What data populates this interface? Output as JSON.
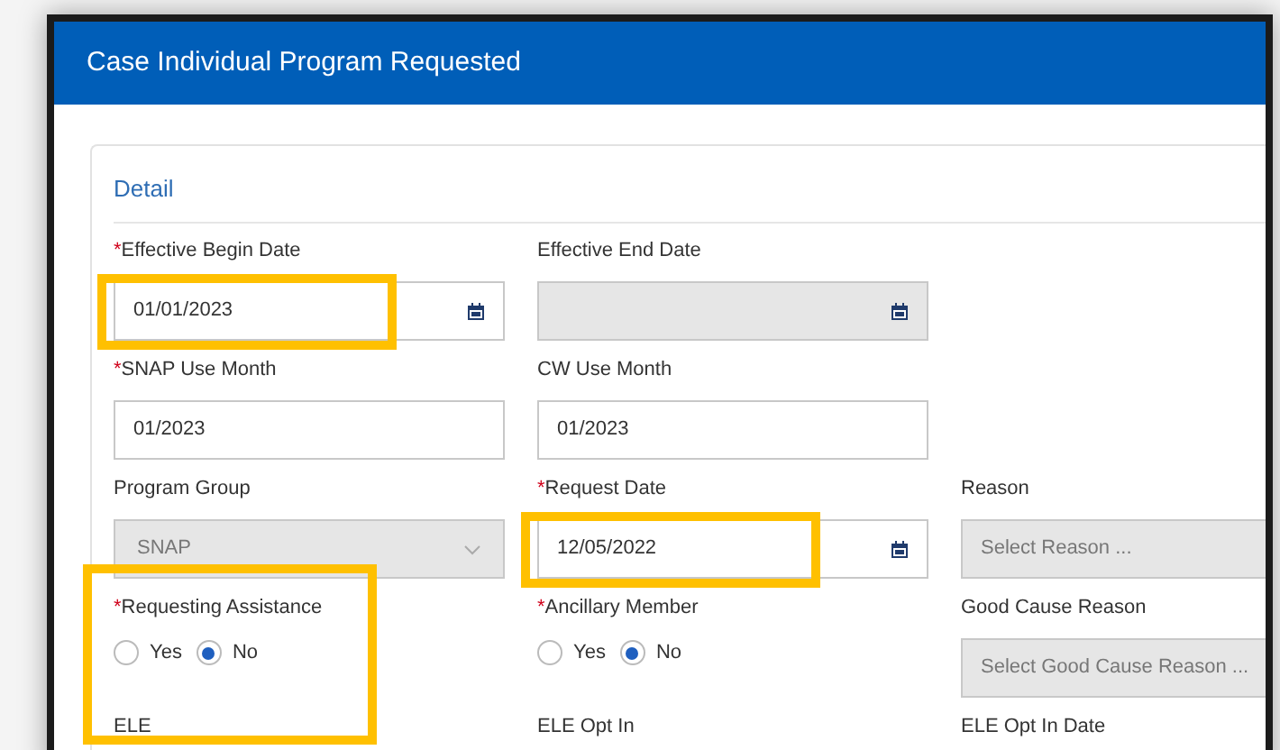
{
  "window": {
    "title": "Case Individual Program Requested"
  },
  "section": {
    "title": "Detail"
  },
  "rows": [
    [
      {
        "kind": "date",
        "label": "Effective Begin Date",
        "required_mark": "*",
        "value": "01/01/2023",
        "disabled": false,
        "highlighted": true
      },
      {
        "kind": "date",
        "label": "Effective End Date",
        "disabled": true,
        "highlighted": false
      }
    ],
    [
      {
        "kind": "text",
        "label": "SNAP Use Month",
        "required_mark": "*",
        "value": "01/2023",
        "disabled": false,
        "highlighted": false
      },
      {
        "kind": "text",
        "label": "CW Use Month",
        "value": "01/2023",
        "disabled": false,
        "highlighted": false
      }
    ],
    [
      {
        "kind": "select",
        "label": "Program Group",
        "value": "SNAP",
        "disabled": true,
        "highlighted": false
      },
      {
        "kind": "date",
        "label": "Request Date",
        "required_mark": "*",
        "value": "12/05/2022",
        "disabled": false,
        "highlighted": true
      },
      {
        "kind": "select",
        "label": "Reason",
        "placeholder": "Select Reason ...",
        "disabled": true,
        "highlighted": false
      }
    ],
    [
      {
        "kind": "radio",
        "label": "Requesting Assistance",
        "required_mark": "*",
        "highlighted": true,
        "options": [
          {
            "label": "Yes",
            "selected": false
          },
          {
            "label": "No",
            "selected": true
          }
        ]
      },
      {
        "kind": "radio",
        "label": "Ancillary Member",
        "required_mark": "*",
        "highlighted": false,
        "options": [
          {
            "label": "Yes",
            "selected": false
          },
          {
            "label": "No",
            "selected": true
          }
        ]
      },
      {
        "kind": "select",
        "label": "Good Cause Reason",
        "placeholder": "Select Good Cause Reason ...",
        "disabled": true,
        "highlighted": false
      }
    ],
    [
      {
        "kind": "label",
        "label": "ELE"
      },
      {
        "kind": "label",
        "label": "ELE Opt In"
      },
      {
        "kind": "label",
        "label": "ELE Opt In Date"
      }
    ]
  ]
}
